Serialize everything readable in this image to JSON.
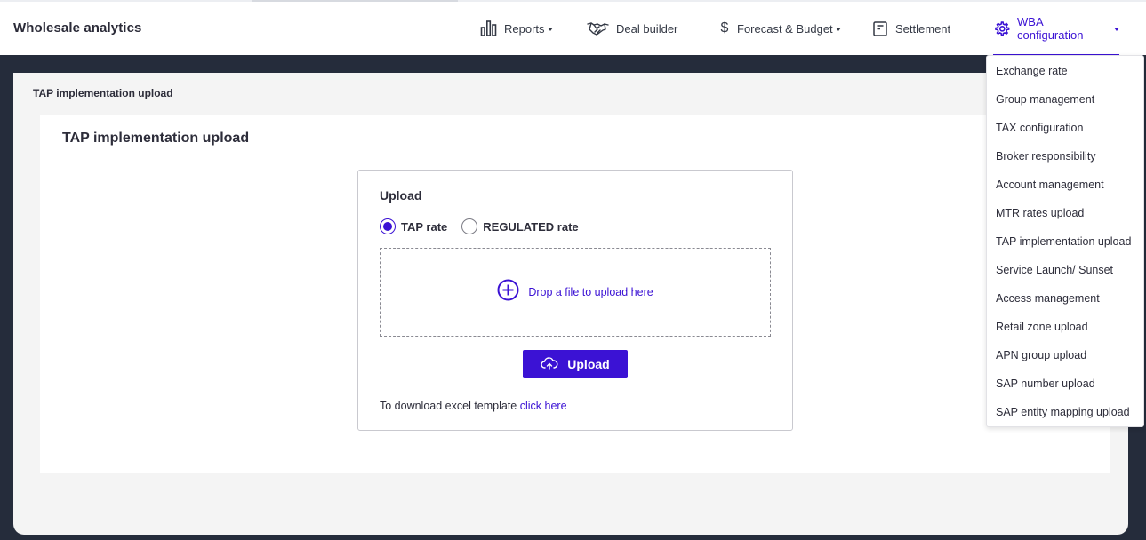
{
  "app": {
    "brand": "Wholesale analytics"
  },
  "nav": {
    "reports": "Reports",
    "deal_builder": "Deal builder",
    "forecast": "Forecast & Budget",
    "settlement": "Settlement",
    "wba_config": "WBA configuration"
  },
  "icons": {
    "reports": "bar-chart-icon",
    "deal_builder": "handshake-icon",
    "forecast": "dollar-icon",
    "settlement": "document-icon",
    "wba_config": "gear-icon",
    "dropzone": "plus-circle-icon",
    "upload": "cloud-upload-icon"
  },
  "colors": {
    "accent": "#3b12d4",
    "dark_background": "#252c3b",
    "content_background": "#f4f4f4"
  },
  "breadcrumb": "TAP implementation upload",
  "page": {
    "title": "TAP implementation upload"
  },
  "upload": {
    "title": "Upload",
    "radio_tap": "TAP rate",
    "radio_regulated": "REGULATED rate",
    "selected": "TAP rate",
    "dropzone_text": "Drop a file to upload here",
    "button_label": "Upload",
    "template_text": "To download excel template",
    "template_link": "click here"
  },
  "dropdown": {
    "items": [
      "Exchange rate",
      "Group management",
      "TAX configuration",
      "Broker responsibility",
      "Account management",
      "MTR rates upload",
      "TAP implementation upload",
      "Service Launch/ Sunset",
      "Access management",
      "Retail zone upload",
      "APN group upload",
      "SAP number upload",
      "SAP entity mapping upload"
    ]
  }
}
